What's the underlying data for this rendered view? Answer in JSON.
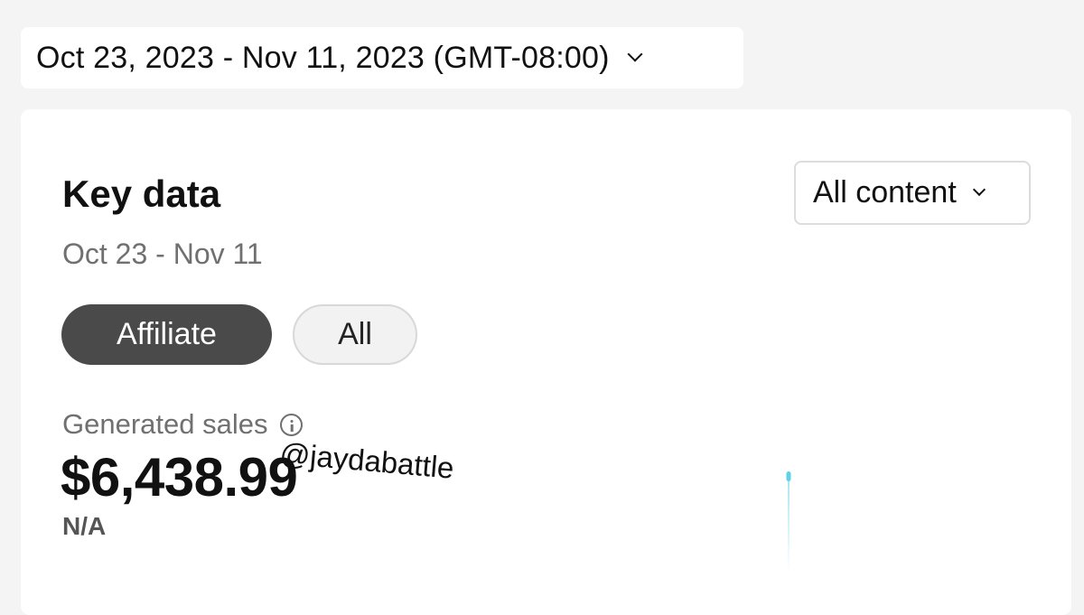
{
  "date_range": {
    "label": "Oct 23, 2023 - Nov 11, 2023 (GMT-08:00)",
    "icon": "chevron-down-icon"
  },
  "key_data": {
    "title": "Key data",
    "subtitle": "Oct 23 - Nov 11",
    "content_filter": {
      "selected": "All content",
      "icon": "chevron-down-icon"
    },
    "toggle": {
      "options": [
        "Affiliate",
        "All"
      ],
      "selected": "Affiliate"
    },
    "metric": {
      "label": "Generated sales",
      "info_icon": "info-icon",
      "value": "$6,438.99",
      "comparison": "N/A"
    },
    "watermark": "@jaydabattle",
    "colors": {
      "selected_pill": "#4a4a4a",
      "sparkline": "#5fd2e6"
    }
  }
}
